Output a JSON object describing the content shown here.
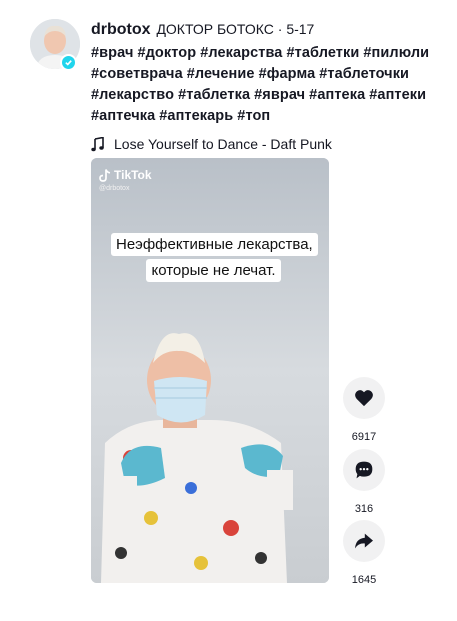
{
  "author": {
    "username": "drbotox",
    "nickname": "ДОКТОР БОТОКС",
    "date_sep": " · ",
    "date": "5-17"
  },
  "hashtags": [
    "#врач",
    "#доктор",
    "#лекарства",
    "#таблетки",
    "#пилюли",
    "#советврача",
    "#лечение",
    "#фарма",
    "#таблеточки",
    "#лекарство",
    "#таблетка",
    "#яврач",
    "#аптека",
    "#аптеки",
    "#аптечка",
    "#аптекарь",
    "#топ"
  ],
  "music": {
    "icon": "music-note-icon",
    "title": "Lose Yourself to Dance - Daft Punk"
  },
  "video": {
    "watermark_logo": "TikTok",
    "watermark_handle": "@drbotox",
    "caption": "Неэффективные лекарства, которые не лечат."
  },
  "actions": {
    "likes": {
      "icon": "heart-icon",
      "count": "6917"
    },
    "comments": {
      "icon": "comment-icon",
      "count": "316"
    },
    "shares": {
      "icon": "share-icon",
      "count": "1645"
    }
  },
  "colors": {
    "text": "#161823",
    "action_bg": "#f1f1f2",
    "verified": "#20d5ec"
  }
}
